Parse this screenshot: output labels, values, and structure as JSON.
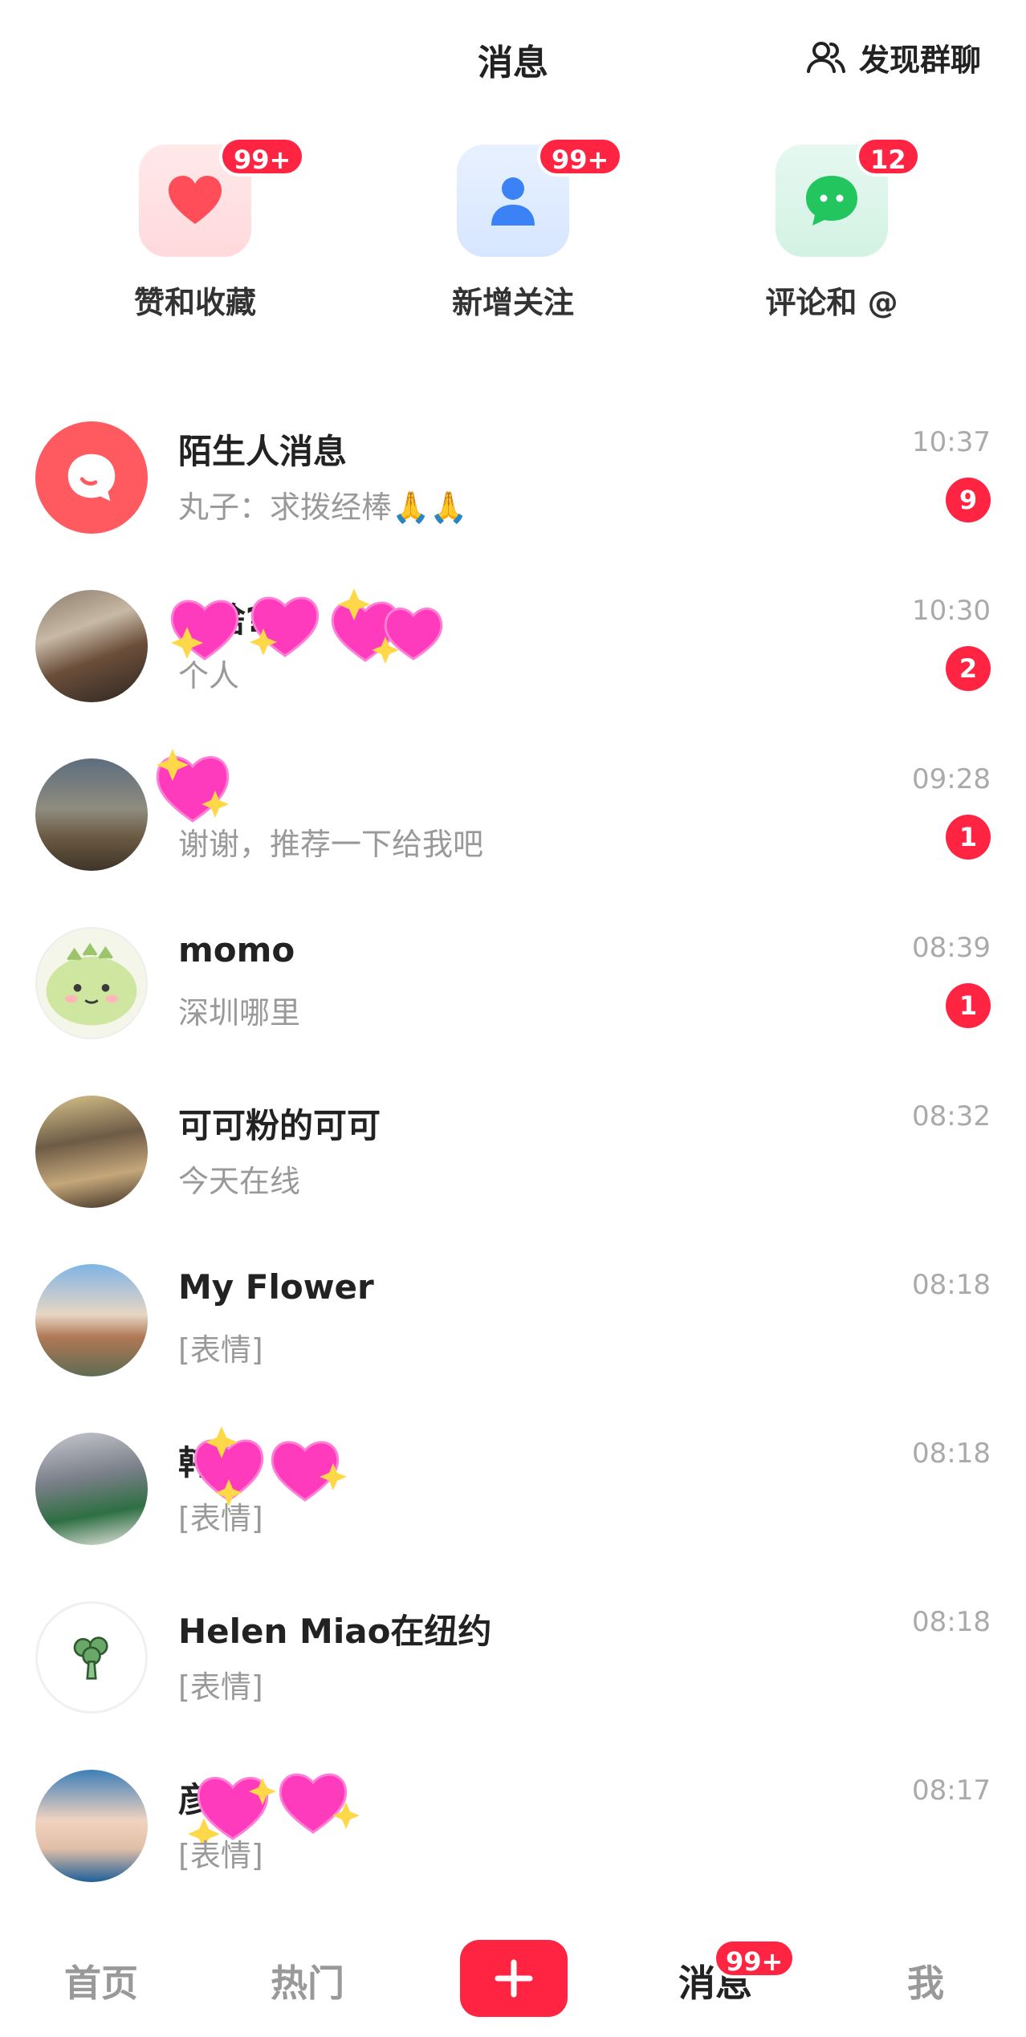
{
  "header": {
    "title": "消息",
    "group_chat_label": "发现群聊",
    "group_chat_icon": "users-icon"
  },
  "categories": [
    {
      "label": "赞和收藏",
      "badge": "99+",
      "icon": "heart-icon",
      "color": "#ff4d5a"
    },
    {
      "label": "新增关注",
      "badge": "99+",
      "icon": "person-icon",
      "color": "#3b82f6"
    },
    {
      "label": "评论和 @",
      "badge": "12",
      "icon": "chat-bubble-icon",
      "color": "#22c55e"
    }
  ],
  "messages": [
    {
      "name": "陌生人消息",
      "preview": "丸子：求拨经棒🙏🙏",
      "time": "10:37",
      "badge": "9"
    },
    {
      "name": "x     啥?",
      "preview": "个人",
      "time": "10:30",
      "badge": "2"
    },
    {
      "name": "",
      "preview": "谢谢，推荐一下给我吧",
      "time": "09:28",
      "badge": "1"
    },
    {
      "name": "momo",
      "preview": "深圳哪里",
      "time": "08:39",
      "badge": "1"
    },
    {
      "name": "可可粉的可可",
      "preview": "今天在线",
      "time": "08:32",
      "badge": ""
    },
    {
      "name": "My Flower",
      "preview": "[表情]",
      "time": "08:18",
      "badge": ""
    },
    {
      "name": "韩",
      "preview": "[表情]",
      "time": "08:18",
      "badge": ""
    },
    {
      "name": "Helen Miao在纽约",
      "preview": "[表情]",
      "time": "08:18",
      "badge": ""
    },
    {
      "name": "彦",
      "preview": "[表情]",
      "time": "08:17",
      "badge": ""
    }
  ],
  "bottom_nav": {
    "home": "首页",
    "hot": "热门",
    "messages": "消息",
    "messages_badge": "99+",
    "me": "我"
  },
  "colors": {
    "accent": "#ff2442"
  }
}
